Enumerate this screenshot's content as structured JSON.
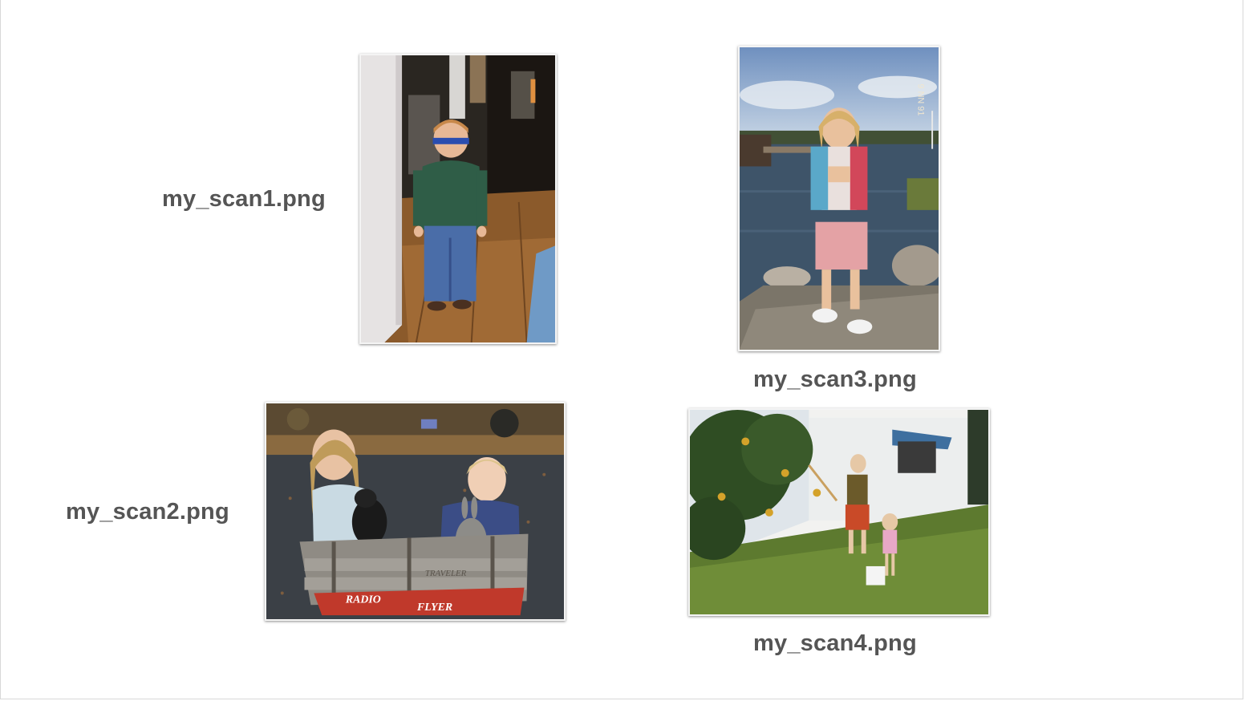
{
  "slide": {
    "background": "#ffffff",
    "label_color": "#555555"
  },
  "photos": [
    {
      "label": "my_scan1.png",
      "subject": "toddler in green shirt and jeans standing in hallway"
    },
    {
      "label": "my_scan2.png",
      "subject": "two children with rabbits in a Radio Flyer wagon"
    },
    {
      "label": "my_scan3.png",
      "subject": "girl in life vest standing on rocks by the water"
    },
    {
      "label": "my_scan4.png",
      "subject": "children picking fruit from a tree beside a white house"
    }
  ],
  "wagon_text": {
    "brand": "RADIO",
    "model": "FLYER",
    "side": "TRAVELER"
  },
  "photo3_stamp": "9 NN 91"
}
